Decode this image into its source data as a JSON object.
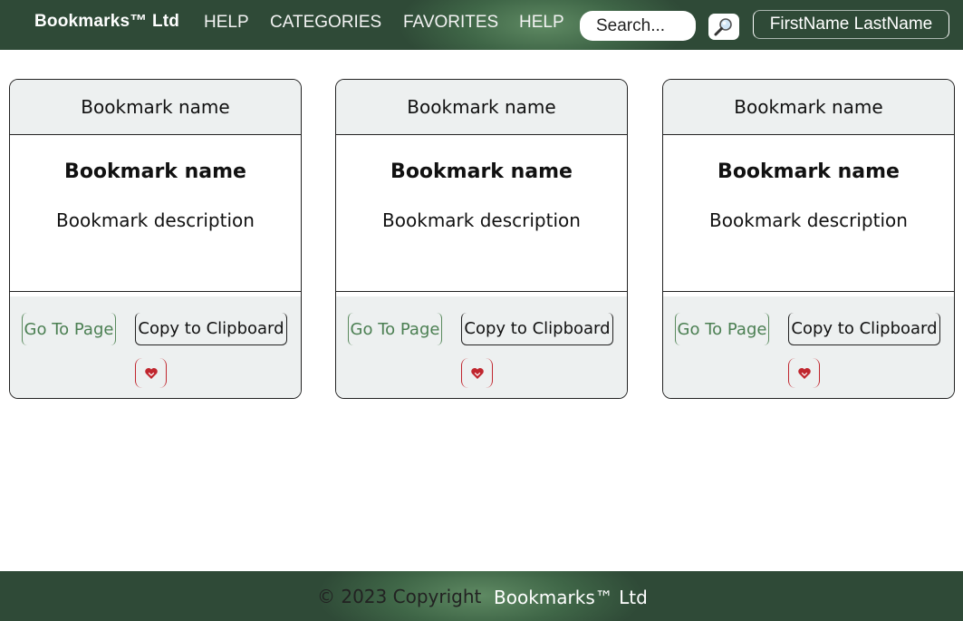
{
  "navbar": {
    "brand": "Bookmarks™ Ltd",
    "links": [
      "HELP",
      "CATEGORIES",
      "FAVORITES",
      "HELP"
    ],
    "search": {
      "placeholder": "Search..."
    },
    "search_icon": "magnifier-icon",
    "user_name": "FirstName LastName"
  },
  "cards": [
    {
      "header": "Bookmark name",
      "title": "Bookmark name",
      "description": "Bookmark description",
      "go_label": "Go To Page",
      "copy_label": "Copy to Clipboard",
      "fav_icon": "heart-icon"
    },
    {
      "header": "Bookmark name",
      "title": "Bookmark name",
      "description": "Bookmark description",
      "go_label": "Go To Page",
      "copy_label": "Copy to Clipboard",
      "fav_icon": "heart-icon"
    },
    {
      "header": "Bookmark name",
      "title": "Bookmark name",
      "description": "Bookmark description",
      "go_label": "Go To Page",
      "copy_label": "Copy to Clipboard",
      "fav_icon": "heart-icon"
    }
  ],
  "footer": {
    "copyright": "© 2023 Copyright",
    "brand": "Bookmarks™ Ltd"
  },
  "colors": {
    "nav_green": "#3f6647",
    "go_green": "#4b7f52",
    "favorite_red": "#c0262e",
    "panel_gray": "#edf0f0"
  }
}
